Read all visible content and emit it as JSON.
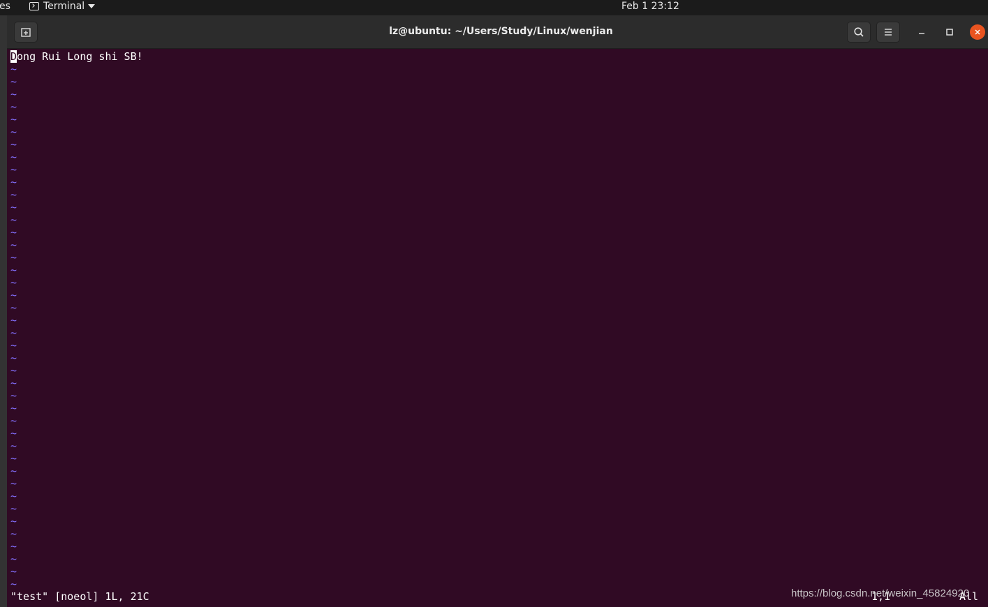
{
  "topbar": {
    "activities_label": "es",
    "app_menu_label": "Terminal",
    "clock": "Feb 1  23:12"
  },
  "window": {
    "title": "lz@ubuntu: ~/Users/Study/Linux/wenjian"
  },
  "vim": {
    "cursor_char": "D",
    "line1_rest": "ong Rui Long shi SB!",
    "tilde_count": 42,
    "status_message": "\"test\" [noeol] 1L, 21C",
    "ruler": "1,1",
    "position": "All"
  },
  "watermark": "https://blog.csdn.net/weixin_45824920",
  "colors": {
    "terminal_bg": "#300a24",
    "tilde": "#8470ff",
    "close_button": "#e95420"
  },
  "icons": [
    "terminal-icon",
    "dropdown-caret-icon",
    "new-tab-icon",
    "search-icon",
    "hamburger-menu-icon",
    "minimize-icon",
    "maximize-icon",
    "close-icon"
  ]
}
